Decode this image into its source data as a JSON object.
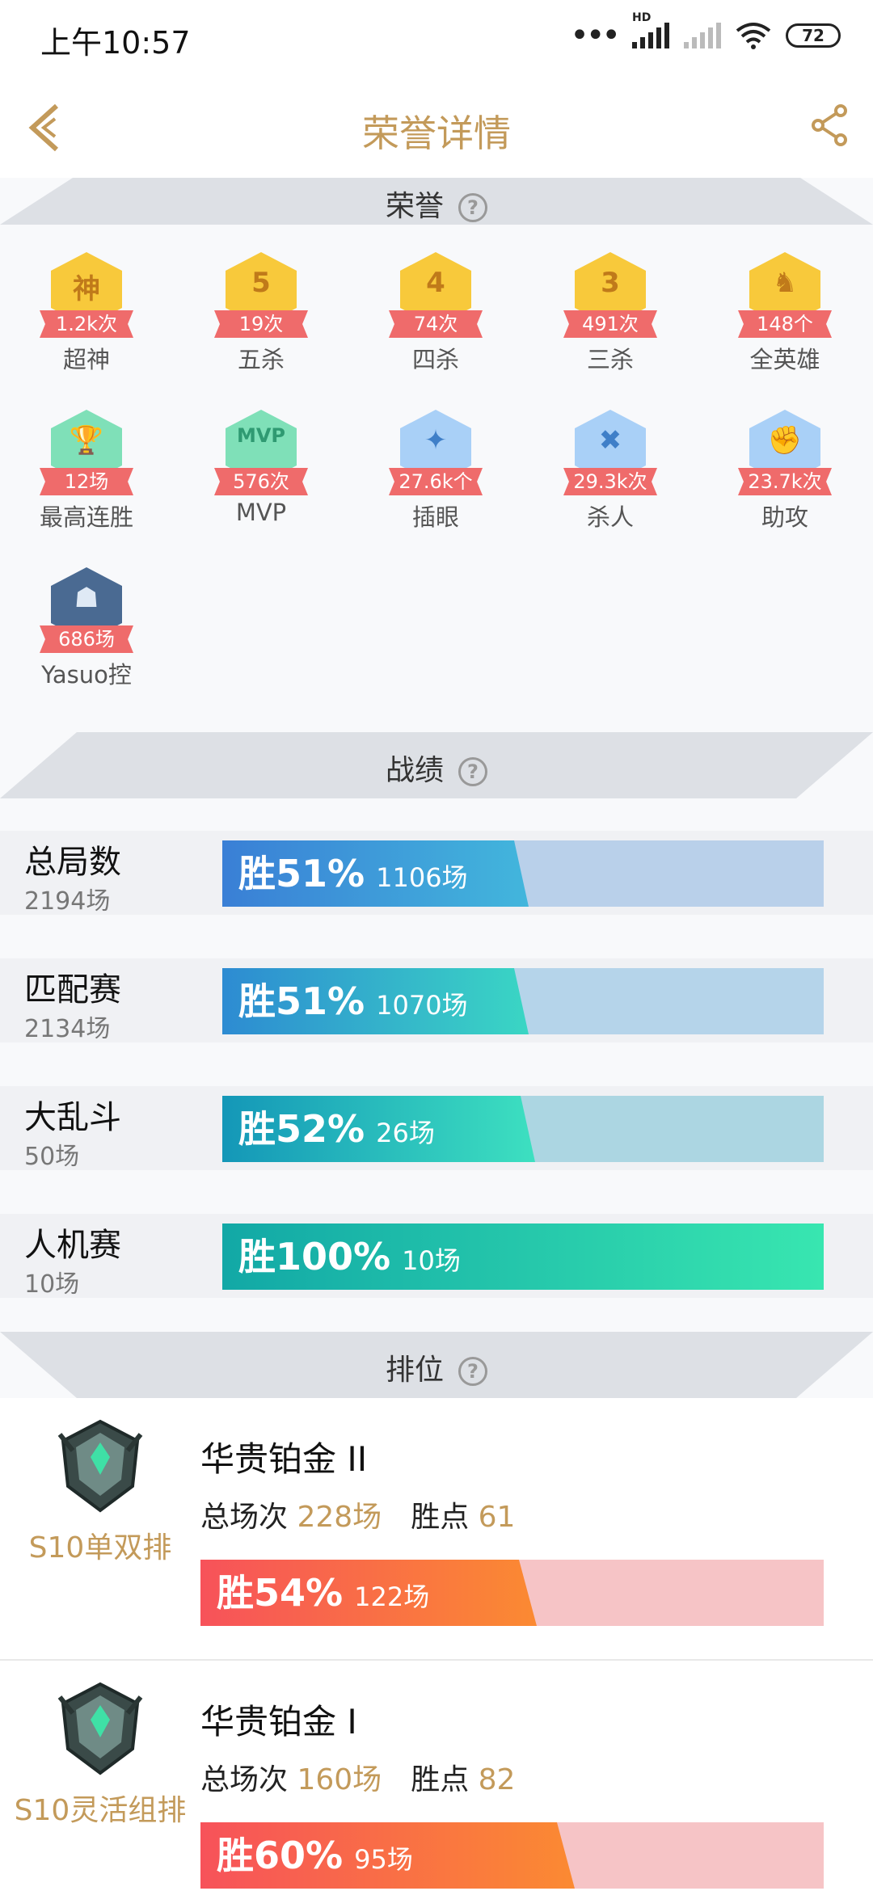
{
  "status_bar": {
    "time": "上午10:57",
    "battery": "72",
    "network": "HD"
  },
  "header": {
    "title": "荣誉详情"
  },
  "sections": {
    "honor": "荣誉",
    "record": "战绩",
    "ranked": "排位"
  },
  "honors": [
    {
      "name": "超神",
      "badge": "1.2k次",
      "glyph": "神",
      "color": "#f8c93b",
      "glyph_color": "#c07a1a"
    },
    {
      "name": "五杀",
      "badge": "19次",
      "glyph": "5",
      "color": "#f8c93b",
      "glyph_color": "#c07a1a"
    },
    {
      "name": "四杀",
      "badge": "74次",
      "glyph": "4",
      "color": "#f8c93b",
      "glyph_color": "#c07a1a"
    },
    {
      "name": "三杀",
      "badge": "491次",
      "glyph": "3",
      "color": "#f8c93b",
      "glyph_color": "#c07a1a"
    },
    {
      "name": "全英雄",
      "badge": "148个",
      "glyph": "♞",
      "color": "#f8c93b",
      "glyph_color": "#c07a1a"
    },
    {
      "name": "最高连胜",
      "badge": "12场",
      "glyph": "🏆",
      "color": "#7fe0b8",
      "glyph_color": "#2f9a72"
    },
    {
      "name": "MVP",
      "badge": "576次",
      "glyph": "MVP",
      "color": "#7fe0b8",
      "glyph_color": "#2f9a72"
    },
    {
      "name": "插眼",
      "badge": "27.6k个",
      "glyph": "✦",
      "color": "#a9d0f7",
      "glyph_color": "#3f7fc8"
    },
    {
      "name": "杀人",
      "badge": "29.3k次",
      "glyph": "✖",
      "color": "#a9d0f7",
      "glyph_color": "#3f7fc8"
    },
    {
      "name": "助攻",
      "badge": "23.7k次",
      "glyph": "✊",
      "color": "#a9d0f7",
      "glyph_color": "#3f7fc8"
    },
    {
      "name": "Yasuo控",
      "badge": "686场",
      "glyph": "☗",
      "color": "#4a6a92",
      "glyph_color": "#dfe9f5"
    }
  ],
  "record": [
    {
      "title": "总局数",
      "sub": "2194场",
      "win_label": "胜51%",
      "games": "1106场",
      "win_rate": 0.51,
      "fill": "linear-gradient(90deg,#3a7fd6,#42b6dc)",
      "track": "#b9d0ea"
    },
    {
      "title": "匹配赛",
      "sub": "2134场",
      "win_label": "胜51%",
      "games": "1070场",
      "win_rate": 0.51,
      "fill": "linear-gradient(90deg,#2d8bd2,#3ad6c4)",
      "track": "#b5d4ea"
    },
    {
      "title": "大乱斗",
      "sub": "50场",
      "win_label": "胜52%",
      "games": "26场",
      "win_rate": 0.52,
      "fill": "linear-gradient(90deg,#1497b8,#3de0c0)",
      "track": "#acd6e2"
    },
    {
      "title": "人机赛",
      "sub": "10场",
      "win_label": "胜100%",
      "games": "10场",
      "win_rate": 1.0,
      "fill": "linear-gradient(90deg,#12a8a6,#38e6b0)",
      "track": "#a7e2d2"
    }
  ],
  "ranked": [
    {
      "mode": "S10单双排",
      "tier": "华贵铂金 II",
      "total_label": "总场次",
      "total": "228场",
      "points_label": "胜点",
      "points": "61",
      "win_label": "胜54%",
      "games": "122场",
      "win_rate": 0.54
    },
    {
      "mode": "S10灵活组排",
      "tier": "华贵铂金 I",
      "total_label": "总场次",
      "total": "160场",
      "points_label": "胜点",
      "points": "82",
      "win_label": "胜60%",
      "games": "95场",
      "win_rate": 0.6
    }
  ]
}
